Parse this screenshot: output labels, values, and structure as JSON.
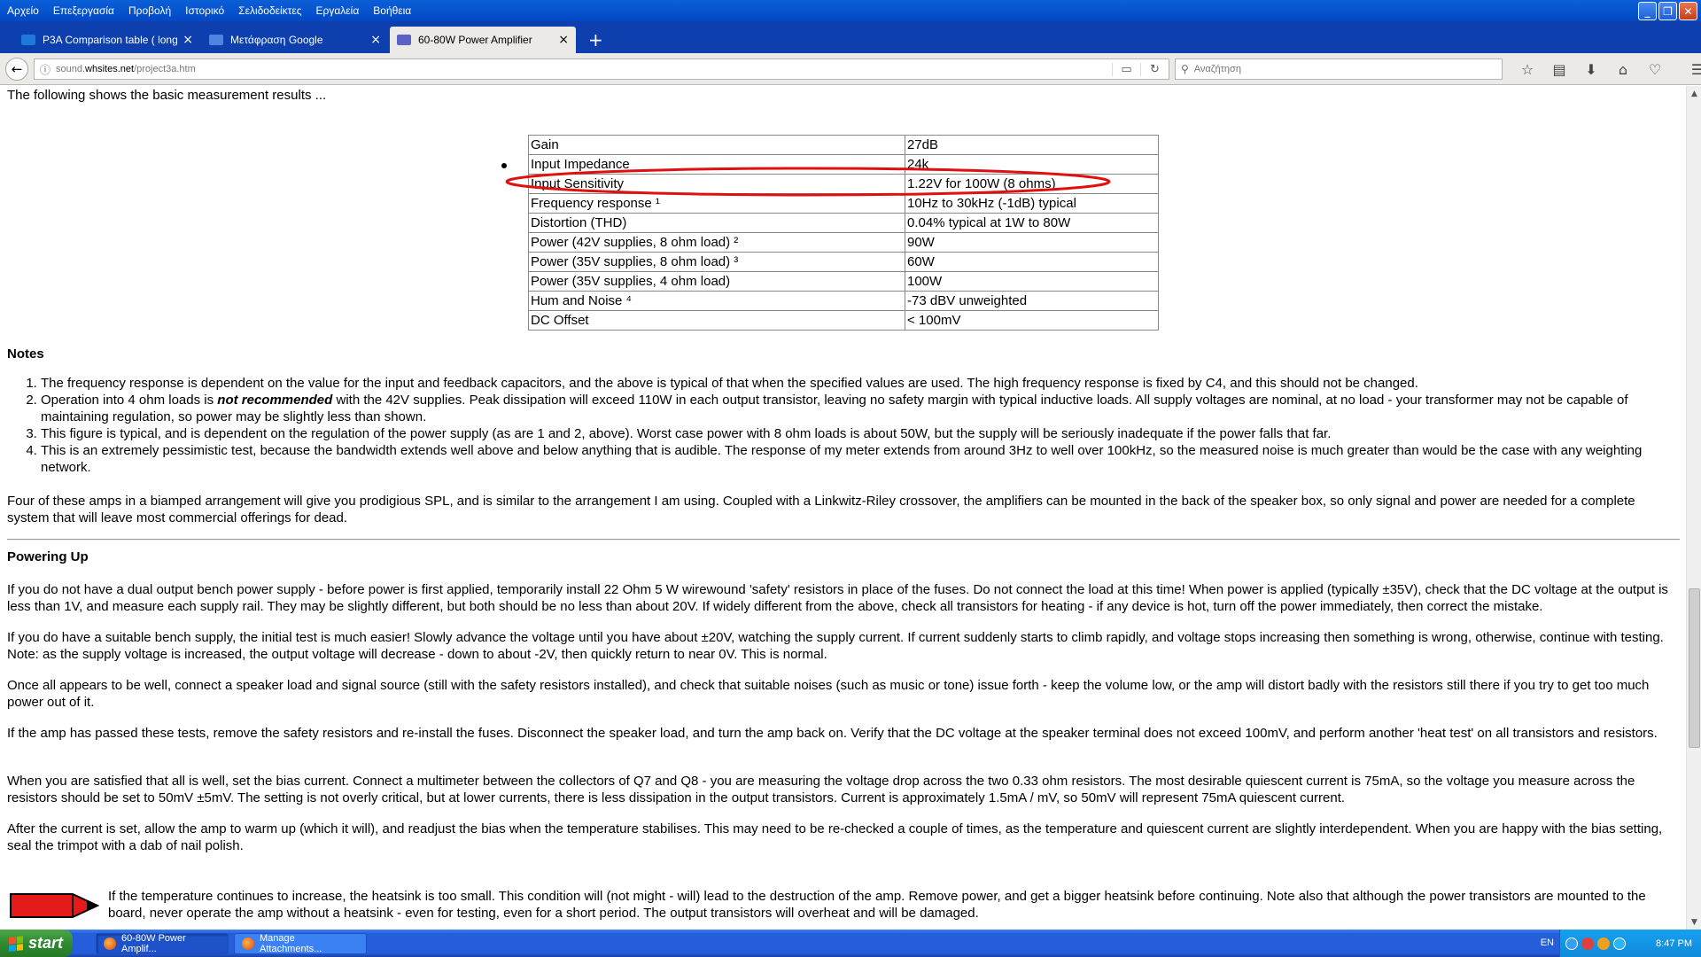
{
  "menu": [
    "Αρχείο",
    "Επεξεργασία",
    "Προβολή",
    "Ιστορικό",
    "Σελιδοδείκτες",
    "Εργαλεία",
    "Βοήθεια"
  ],
  "tabs": [
    {
      "label": "P3A Comparison table ( long ...",
      "close": "×",
      "favicon_color": "#1a7ad8"
    },
    {
      "label": "Μετάφραση Google",
      "close": "×",
      "favicon_color": "#4f83e0"
    },
    {
      "label": "60-80W Power Amplifier",
      "close": "×",
      "favicon_color": "#5a62c8"
    }
  ],
  "new_tab": "+",
  "nav": {
    "url_host": "sound.",
    "url_domain": "whsites.net",
    "url_path": "/project3a.htm",
    "search_placeholder": "Αναζήτηση"
  },
  "page": {
    "intro": "The following shows the basic measurement results ...",
    "table": [
      [
        "Gain",
        "27dB"
      ],
      [
        "Input Impedance",
        "24k"
      ],
      [
        "Input Sensitivity",
        "1.22V for 100W (8 ohms)"
      ],
      [
        "Frequency response ¹",
        "10Hz to 30kHz (-1dB) typical"
      ],
      [
        "Distortion (THD)",
        "0.04% typical at 1W to 80W"
      ],
      [
        "Power (42V supplies, 8 ohm load) ²",
        "90W"
      ],
      [
        "Power (35V supplies, 8 ohm load) ³",
        "60W"
      ],
      [
        "Power (35V supplies, 4 ohm load)",
        "100W"
      ],
      [
        "Hum and Noise ⁴",
        "-73 dBV unweighted"
      ],
      [
        "DC Offset",
        "< 100mV"
      ]
    ],
    "notes_heading": "Notes",
    "notes": [
      "The frequency response is dependent on the value for the input and feedback capacitors, and the above is typical of that when the specified values are used. The high frequency response is fixed by C4, and this should not be changed.",
      {
        "pre": "Operation into 4 ohm loads is ",
        "em": "not recommended",
        "post": " with the 42V supplies. Peak dissipation will exceed 110W in each output transistor, leaving no safety margin with typical inductive loads. All supply voltages are nominal, at no load - your transformer may not be capable of maintaining regulation, so power may be slightly less than shown."
      },
      "This figure is typical, and is dependent on the regulation of the power supply (as are 1 and 2, above). Worst case power with 8 ohm loads is about 50W, but the supply will be seriously inadequate if the power falls that far.",
      "This is an extremely pessimistic test, because the bandwidth extends well above and below anything that is audible. The response of my meter extends from around 3Hz to well over 100kHz, so the measured noise is much greater than would be the case with any weighting network."
    ],
    "biamp_para": "Four of these amps in a biamped arrangement will give you prodigious SPL, and is similar to the arrangement I am using. Coupled with a Linkwitz-Riley crossover, the amplifiers can be mounted in the back of the speaker box, so only signal and power are needed for a complete system that will leave most commercial offerings for dead.",
    "powering_heading": "Powering Up",
    "powering_paras": [
      "If you do not have a dual output bench power supply - before power is first applied, temporarily install 22 Ohm 5 W wirewound 'safety' resistors in place of the fuses. Do not connect the load at this time! When power is applied (typically ±35V), check that the DC voltage at the output is less than 1V, and measure each supply rail. They may be slightly different, but both should be no less than about 20V. If widely different from the above, check all transistors for heating - if any device is hot, turn off the power immediately, then correct the mistake.",
      "If you do have a suitable bench supply, the initial test is much easier! Slowly advance the voltage until you have about ±20V, watching the supply current. If current suddenly starts to climb rapidly, and voltage stops increasing then something is wrong, otherwise, continue with testing. Note: as the supply voltage is increased, the output voltage will decrease - down to about -2V, then quickly return to near 0V. This is normal.",
      "Once all appears to be well, connect a speaker load and signal source (still with the safety resistors installed), and check that suitable noises (such as music or tone) issue forth - keep the volume low, or the amp will distort badly with the resistors still there if you try to get too much power out of it.",
      "If the amp has passed these tests, remove the safety resistors and re-install the fuses. Disconnect the speaker load, and turn the amp back on. Verify that the DC voltage at the speaker terminal does not exceed 100mV, and perform another 'heat test' on all transistors and resistors.",
      "When you are satisfied that all is well, set the bias current. Connect a multimeter between the collectors of Q7 and Q8 - you are measuring the voltage drop across the two 0.33 ohm resistors. The most desirable quiescent current is 75mA, so the voltage you measure across the resistors should be set to 50mV ±5mV. The setting is not overly critical, but at lower currents, there is less dissipation in the output transistors. Current is approximately 1.5mA / mV, so 50mV will represent 75mA quiescent current.",
      "After the current is set, allow the amp to warm up (which it will), and readjust the bias when the temperature stabilises. This may need to be re-checked a couple of times, as the temperature and quiescent current are slightly interdependent. When you are happy with the bias setting, seal the trimpot with a dab of nail polish."
    ],
    "warning": "If the temperature continues to increase, the heatsink is too small. This condition will (not might - will) lead to the destruction of the amp. Remove power, and get a bigger heatsink before continuing. Note also that although the power transistors are mounted to the board, never operate the amp without a heatsink - even for testing, even for a short period. The output transistors will overheat and will be damaged."
  },
  "taskbar": {
    "start": "start",
    "tasks": [
      "60-80W Power Amplif...",
      "Manage Attachments..."
    ],
    "lang": "EN",
    "clock": "8:47 PM"
  },
  "colors": {
    "annotation": "#e01010",
    "titlebar": "#0a5fd8",
    "taskbar": "#245edb"
  }
}
